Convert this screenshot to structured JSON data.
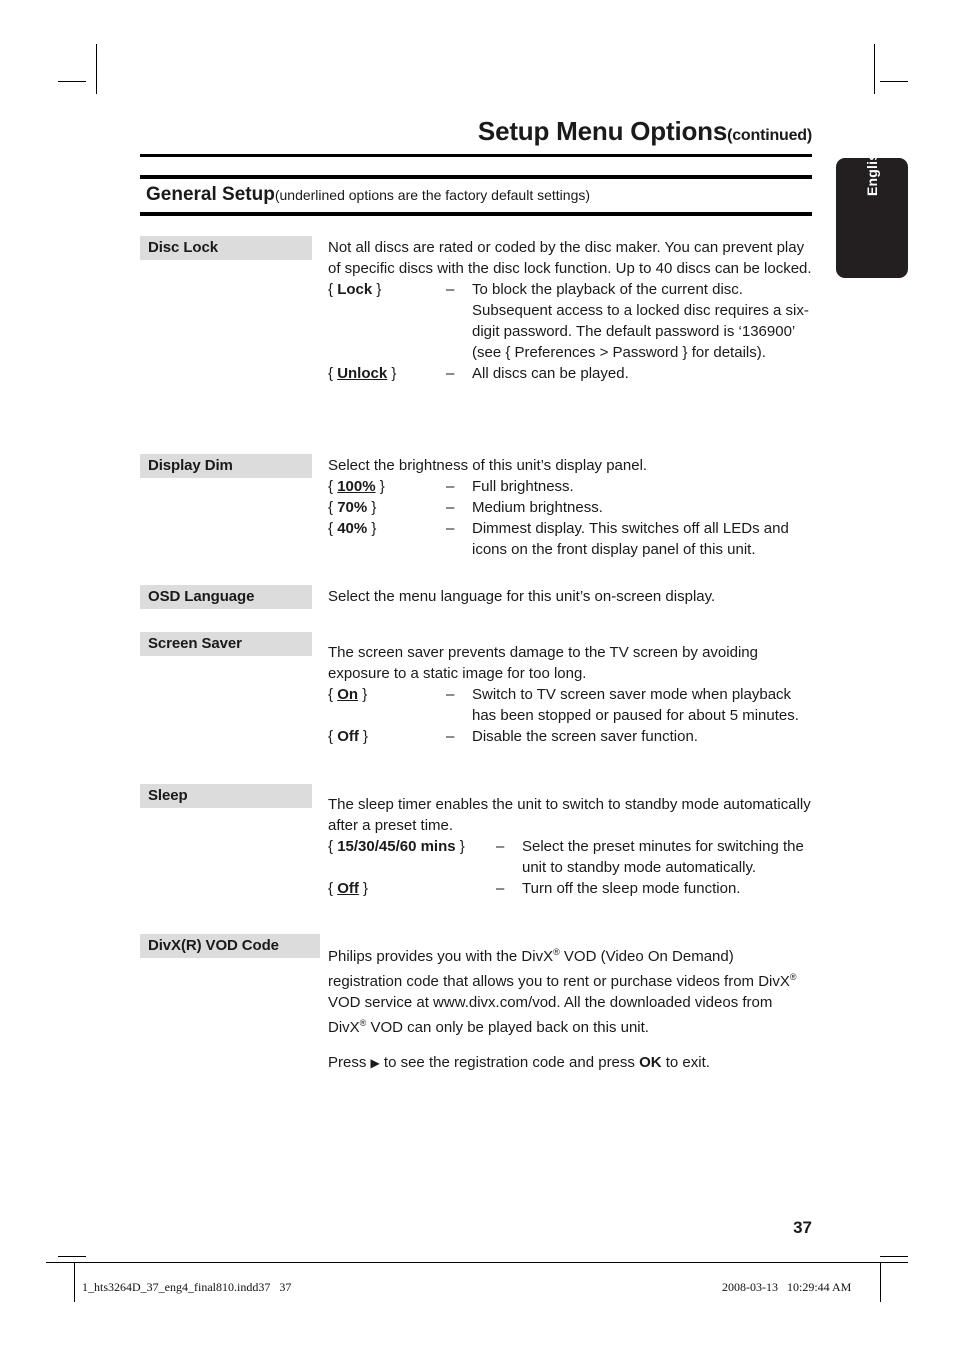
{
  "header": {
    "title": "Setup Menu Options",
    "title_suffix": "(continued)",
    "section_heading": "General Setup",
    "section_note": "(underlined options are the factory default settings)"
  },
  "language_tab": {
    "label": "English",
    "background": "#231f20",
    "text_color": "#ffffff"
  },
  "colors": {
    "term_background": "#dcdcdc",
    "rule": "#000000",
    "text": "#1a1a1a"
  },
  "entries": [
    {
      "term": "Disc Lock",
      "intro": "Not all discs are rated or coded by the disc maker. You can prevent play of specific discs with the disc lock function. Up to 40 discs can be locked.",
      "options": [
        {
          "key_prefix": "{ ",
          "key_bold": "Lock",
          "key_suffix": " }",
          "key_underline": false,
          "dash": "–",
          "desc": "To block the playback of the current disc. Subsequent access to a locked disc requires a six-digit password. The default password is ‘136900’ (see { Preferences > Password } for details)."
        },
        {
          "key_prefix": "{ ",
          "key_bold": "Unlock",
          "key_suffix": " }",
          "key_underline": true,
          "dash": "–",
          "desc": "All discs can be played."
        }
      ]
    },
    {
      "term": "Display Dim",
      "intro": "Select the brightness of this unit’s display panel.",
      "options": [
        {
          "key_prefix": "{ ",
          "key_bold": "100%",
          "key_suffix": " }",
          "key_underline": true,
          "dash": "–",
          "desc": "Full brightness."
        },
        {
          "key_prefix": "{ ",
          "key_bold": "70%",
          "key_suffix": " }",
          "key_underline": false,
          "dash": "–",
          "desc": "Medium brightness."
        },
        {
          "key_prefix": "{ ",
          "key_bold": "40%",
          "key_suffix": " }",
          "key_underline": false,
          "dash": "–",
          "desc": "Dimmest display.  This switches off all LEDs and icons on the front display panel of this unit."
        }
      ]
    },
    {
      "term": "OSD Language",
      "intro": "Select the menu language for this unit’s on-screen display.",
      "options": []
    },
    {
      "term": "Screen Saver",
      "intro": "The screen saver prevents damage to the TV screen by avoiding exposure to a static image for too long.",
      "options": [
        {
          "key_prefix": "{ ",
          "key_bold": "On",
          "key_suffix": " }",
          "key_underline": true,
          "dash": "–",
          "desc": "Switch to TV screen saver mode when playback has been stopped or paused for about 5 minutes."
        },
        {
          "key_prefix": "{ ",
          "key_bold": "Off",
          "key_suffix": " }",
          "key_underline": false,
          "dash": "–",
          "desc": "Disable the screen saver function."
        }
      ]
    },
    {
      "term": "Sleep",
      "intro": "The sleep timer enables the unit to switch to standby mode automatically after a preset time.",
      "options": [
        {
          "key_prefix": "{ ",
          "key_bold": "15/30/45/60 mins",
          "key_suffix": " }",
          "key_underline": false,
          "dash": "–",
          "desc": "Select the preset minutes for switching the unit to standby mode automatically."
        },
        {
          "key_prefix": "{ ",
          "key_bold": "Off",
          "key_suffix": " }",
          "key_underline": true,
          "dash": "–",
          "desc": "Turn off the sleep mode function."
        }
      ]
    },
    {
      "term": "DivX(R) VOD Code",
      "intro_html": true,
      "intro_part1": "Philips provides you with the DivX",
      "intro_part2": " VOD (Video On Demand) registration code that allows you to rent or purchase videos from DivX",
      "intro_part3": " VOD service at www.divx.com/vod. All the downloaded videos from DivX",
      "intro_part4": " VOD can only be played back on this unit.",
      "registered_mark": "®",
      "press_part1": "Press ",
      "press_triangle": "▶",
      "press_part2": " to see the registration code and press ",
      "press_ok": "OK",
      "press_part3": " to exit.",
      "options": []
    }
  ],
  "footer": {
    "page_number": "37",
    "file_name": "1_hts3264D_37_eng4_final810.indd37   37",
    "timestamp": "2008-03-13   10:29:44 AM"
  }
}
